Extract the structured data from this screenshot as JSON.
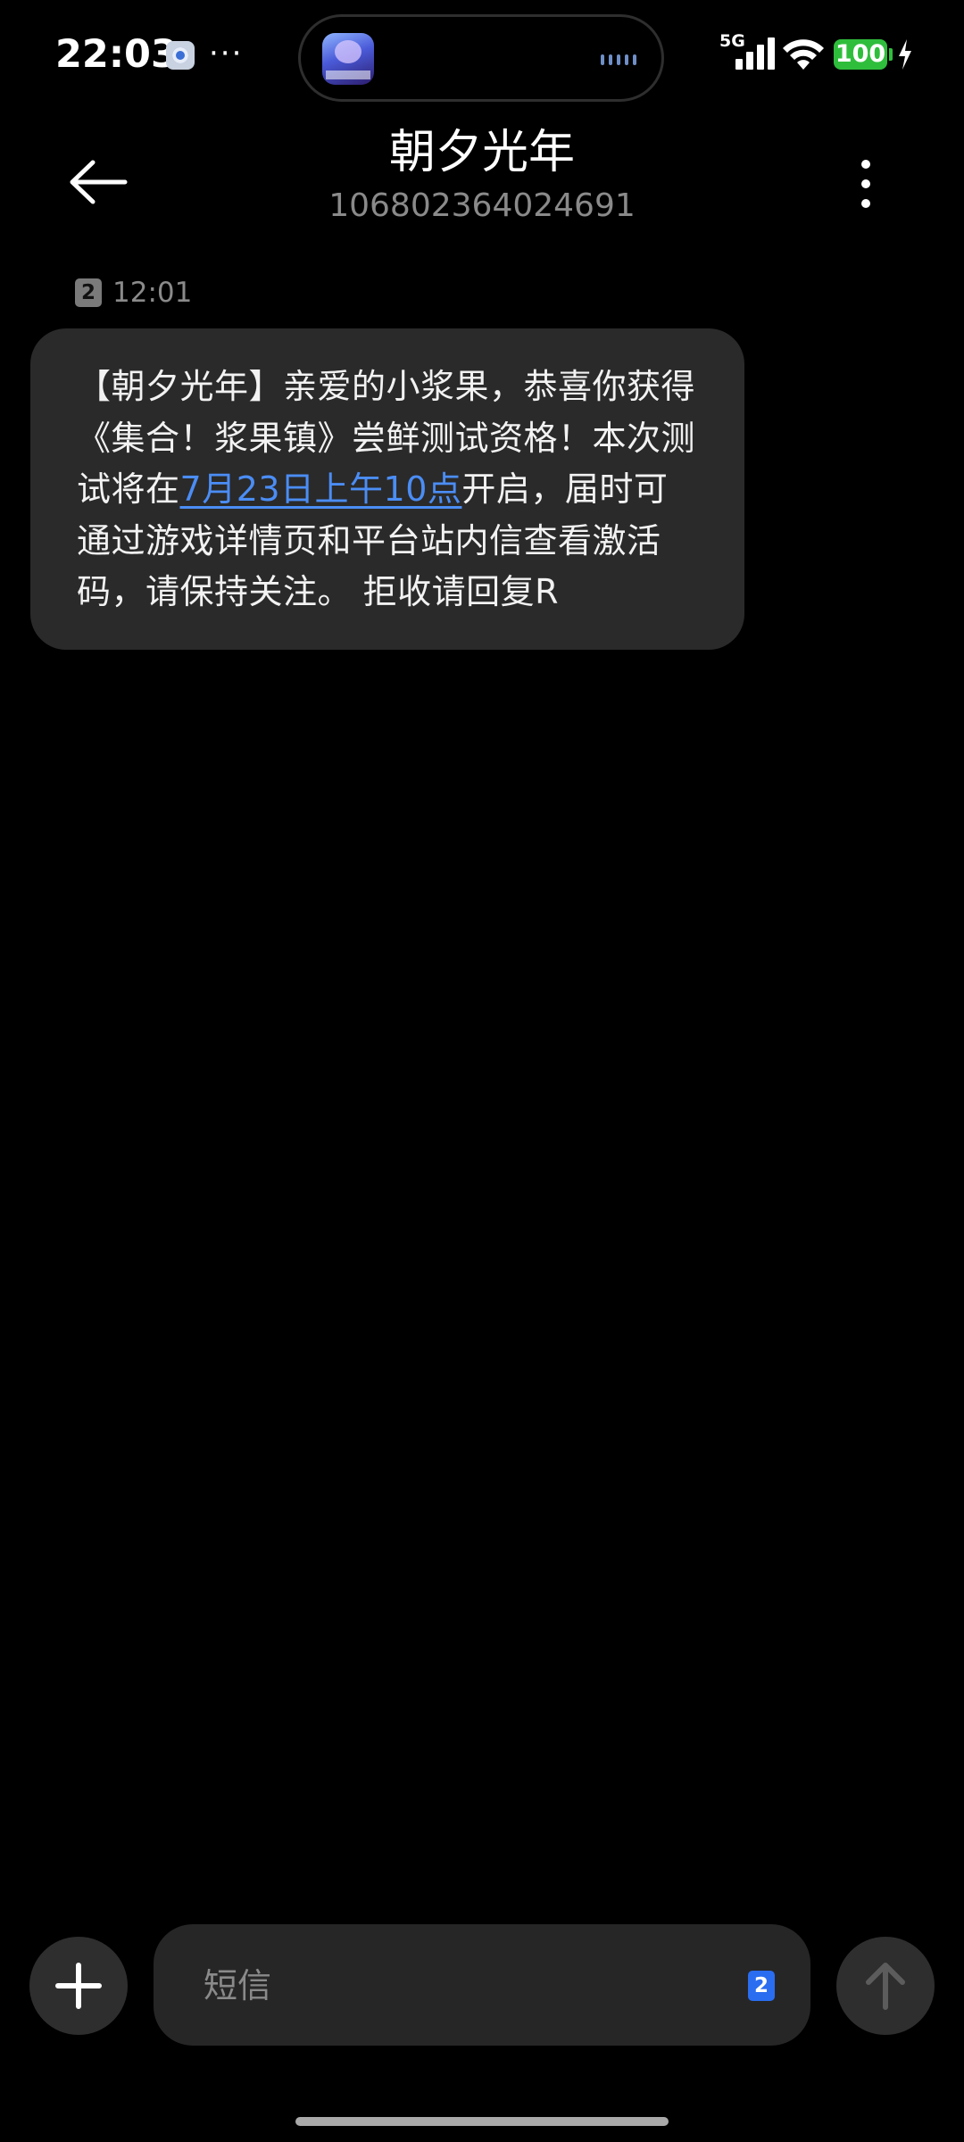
{
  "status_bar": {
    "time": "22:03",
    "more_glyph": "···",
    "network_type": "5G",
    "battery_level": "100",
    "icons": [
      "notification-app-icon",
      "signal-icon",
      "wifi-icon",
      "battery-icon",
      "charging-icon"
    ],
    "battery_color": "#2fbe3c"
  },
  "dynamic_island": {
    "icon": "game-app-icon"
  },
  "header": {
    "contact_name": "朝夕光年",
    "contact_number": "106802364024691",
    "back_icon": "arrow-left-icon",
    "more_icon": "more-vertical-icon"
  },
  "message": {
    "sim_slot": "2",
    "time": "12:01",
    "text_before_link": "【朝夕光年】亲爱的小浆果，恭喜你获得《集合！浆果镇》尝鲜测试资格！本次测试将在",
    "link_text": "7月23日上午10点",
    "text_after_link": "开启，届时可通过游戏详情页和平台站内信查看激活码，请保持关注。 拒收请回复R",
    "link_color": "#4b8df5",
    "bubble_color": "#2a2a2a"
  },
  "compose": {
    "placeholder": "短信",
    "value": "",
    "sim_slot": "2",
    "add_icon": "plus-icon",
    "send_icon": "arrow-up-icon",
    "sim_badge_color": "#2a6df0"
  }
}
